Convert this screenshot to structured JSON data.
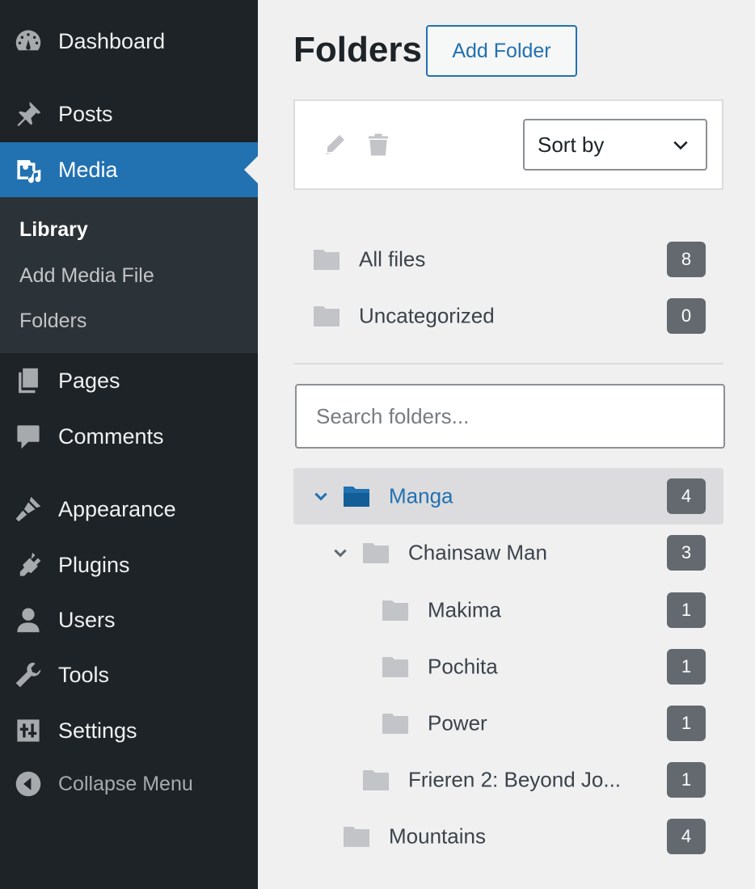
{
  "sidebar": {
    "items": [
      {
        "label": "Dashboard",
        "icon": "dashboard-icon"
      },
      {
        "label": "Posts",
        "icon": "pushpin-icon"
      },
      {
        "label": "Media",
        "icon": "media-icon"
      },
      {
        "label": "Pages",
        "icon": "pages-icon"
      },
      {
        "label": "Comments",
        "icon": "comment-icon"
      },
      {
        "label": "Appearance",
        "icon": "paintbrush-icon"
      },
      {
        "label": "Plugins",
        "icon": "plug-icon"
      },
      {
        "label": "Users",
        "icon": "user-icon"
      },
      {
        "label": "Tools",
        "icon": "wrench-icon"
      },
      {
        "label": "Settings",
        "icon": "sliders-icon"
      }
    ],
    "submenu": [
      "Library",
      "Add Media File",
      "Folders"
    ],
    "collapse_label": "Collapse Menu",
    "active_item": "Media",
    "active_sub": "Library"
  },
  "main": {
    "title": "Folders",
    "add_folder_label": "Add Folder",
    "sort_label": "Sort by",
    "search_placeholder": "Search folders...",
    "system_folders": [
      {
        "name": "All files",
        "count": "8"
      },
      {
        "name": "Uncategorized",
        "count": "0"
      }
    ],
    "tree": [
      {
        "name": "Manga",
        "count": "4",
        "level": 0,
        "expanded": true,
        "selected": true
      },
      {
        "name": "Chainsaw Man",
        "count": "3",
        "level": 1,
        "expanded": true
      },
      {
        "name": "Makima",
        "count": "1",
        "level": 2
      },
      {
        "name": "Pochita",
        "count": "1",
        "level": 2
      },
      {
        "name": "Power",
        "count": "1",
        "level": 2
      },
      {
        "name": "Frieren 2: Beyond Jo...",
        "count": "1",
        "level": 1
      },
      {
        "name": "Mountains",
        "count": "4",
        "level": 0
      }
    ]
  },
  "colors": {
    "sidebar_bg": "#1d2327",
    "accent": "#2271b1",
    "badge_bg": "#646970",
    "folder_gray": "#c3c4c7"
  }
}
